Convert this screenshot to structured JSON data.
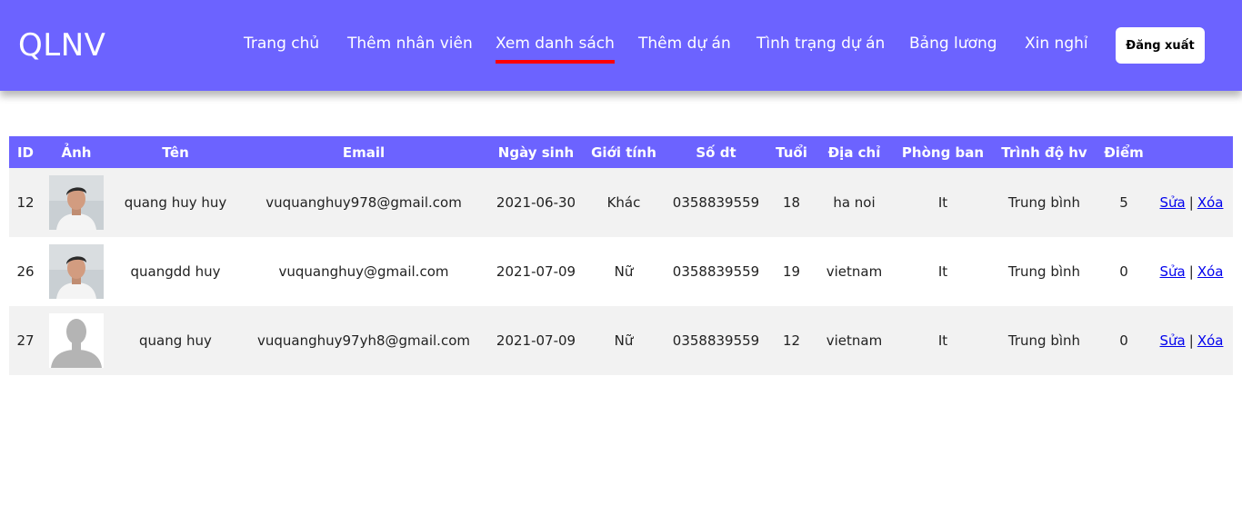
{
  "header": {
    "logo": "QLNV",
    "nav": [
      {
        "label": "Trang chủ"
      },
      {
        "label": "Thêm nhân viên"
      },
      {
        "label": "Xem danh sách"
      },
      {
        "label": "Thêm dự án"
      },
      {
        "label": "Tình trạng dự án"
      },
      {
        "label": "Bảng lương"
      },
      {
        "label": "Xin nghỉ"
      }
    ],
    "active_nav": "Xem danh sách",
    "logout_label": "Đăng xuất"
  },
  "colors": {
    "primary": "#6c63ff",
    "active_underline": "#ff0000",
    "link": "#0000ee",
    "row_alt": "#f2f2f2"
  },
  "table": {
    "headers": [
      "ID",
      "Ảnh",
      "Tên",
      "Email",
      "Ngày sinh",
      "Giới tính",
      "Số dt",
      "Tuổi",
      "Địa chỉ",
      "Phòng ban",
      "Trình độ hv",
      "Điểm",
      ""
    ],
    "rows": [
      {
        "id": "12",
        "avatar": "person-photo",
        "name": "quang huy huy",
        "email": "vuquanghuy978@gmail.com",
        "dob": "2021-06-30",
        "gender": "Khác",
        "phone": "0358839559",
        "age": "18",
        "address": "ha noi",
        "department": "It",
        "education": "Trung bình",
        "score": "5",
        "edit": "Sửa",
        "sep": "|",
        "delete": "Xóa"
      },
      {
        "id": "26",
        "avatar": "person-photo",
        "name": "quangdd huy",
        "email": "vuquanghuy@gmail.com",
        "dob": "2021-07-09",
        "gender": "Nữ",
        "phone": "0358839559",
        "age": "19",
        "address": "vietnam",
        "department": "It",
        "education": "Trung bình",
        "score": "0",
        "edit": "Sửa",
        "sep": "|",
        "delete": "Xóa"
      },
      {
        "id": "27",
        "avatar": "default-avatar",
        "name": "quang huy",
        "email": "vuquanghuy97yh8@gmail.com",
        "dob": "2021-07-09",
        "gender": "Nữ",
        "phone": "0358839559",
        "age": "12",
        "address": "vietnam",
        "department": "It",
        "education": "Trung bình",
        "score": "0",
        "edit": "Sửa",
        "sep": "|",
        "delete": "Xóa"
      }
    ]
  }
}
